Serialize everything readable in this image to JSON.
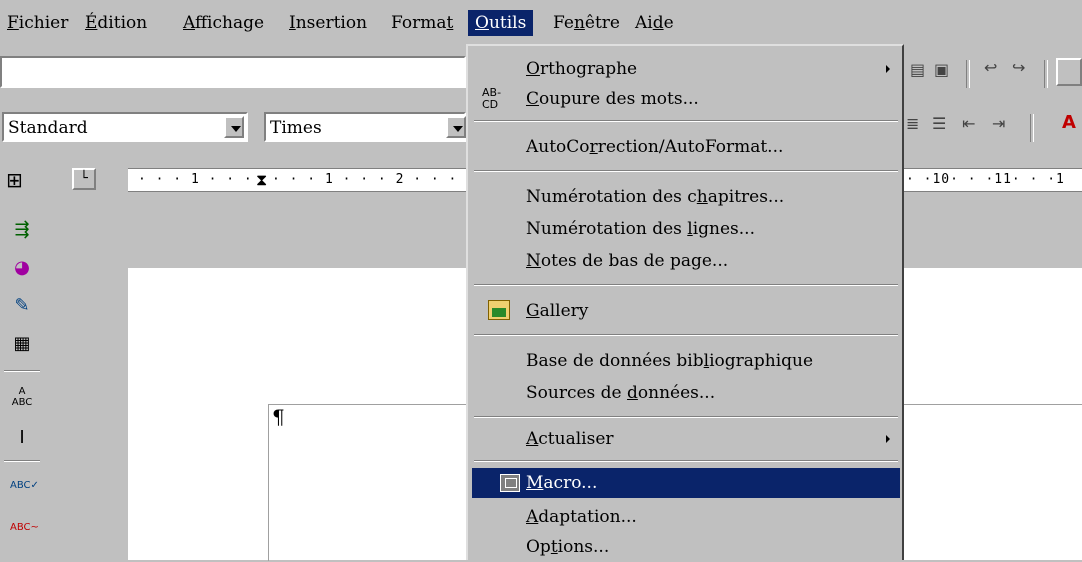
{
  "menubar": {
    "fichier": {
      "pre": "",
      "u": "F",
      "post": "ichier"
    },
    "edition": {
      "pre": "",
      "u": "É",
      "post": "dition"
    },
    "affichage": {
      "pre": "",
      "u": "A",
      "post": "ffichage"
    },
    "insertion": {
      "pre": "",
      "u": "I",
      "post": "nsertion"
    },
    "format": {
      "pre": "Forma",
      "u": "t",
      "post": ""
    },
    "outils": {
      "pre": "",
      "u": "O",
      "post": "utils"
    },
    "fenetre": {
      "pre": "Fe",
      "u": "n",
      "post": "être"
    },
    "aide": {
      "pre": "Ai",
      "u": "d",
      "post": "e"
    }
  },
  "toolbar": {
    "style_value": "Standard",
    "font_value": "Times"
  },
  "ruler": {
    "left_text": "· · · 1 · · ·",
    "mid_text": "· · · 1 · · · 2 · · ·",
    "right_text": "· ·10· · ·11· · ·1"
  },
  "document": {
    "pilcrow": "¶"
  },
  "tools_menu": {
    "orthographe": {
      "pre": "",
      "u": "O",
      "post": "rthographe"
    },
    "coupure": {
      "pre": "",
      "u": "C",
      "post": "oupure des mots..."
    },
    "coupure_icon_text": "AB-\nCD",
    "autocorrection": {
      "pre": "AutoCo",
      "u": "r",
      "post": "rection/AutoFormat..."
    },
    "numerotation_chapitres": {
      "pre": "Numérotation des c",
      "u": "h",
      "post": "apitres..."
    },
    "numerotation_lignes": {
      "pre": "Numérotation des ",
      "u": "l",
      "post": "ignes..."
    },
    "notes": {
      "pre": "",
      "u": "N",
      "post": "otes de bas de page..."
    },
    "gallery": {
      "pre": "",
      "u": "G",
      "post": "allery"
    },
    "base_donnees": {
      "pre": "Base de données bib",
      "u": "l",
      "post": "iographique"
    },
    "sources": {
      "pre": "Sources de ",
      "u": "d",
      "post": "onnées..."
    },
    "actualiser": {
      "pre": "",
      "u": "A",
      "post": "ctualiser"
    },
    "macro": {
      "pre": "",
      "u": "M",
      "post": "acro..."
    },
    "adaptation": {
      "pre": "",
      "u": "A",
      "post": "daptation..."
    },
    "options": {
      "pre": "Op",
      "u": "t",
      "post": "ions..."
    }
  },
  "colors": {
    "highlight": "#0a246a",
    "face": "#c0c0c0"
  }
}
